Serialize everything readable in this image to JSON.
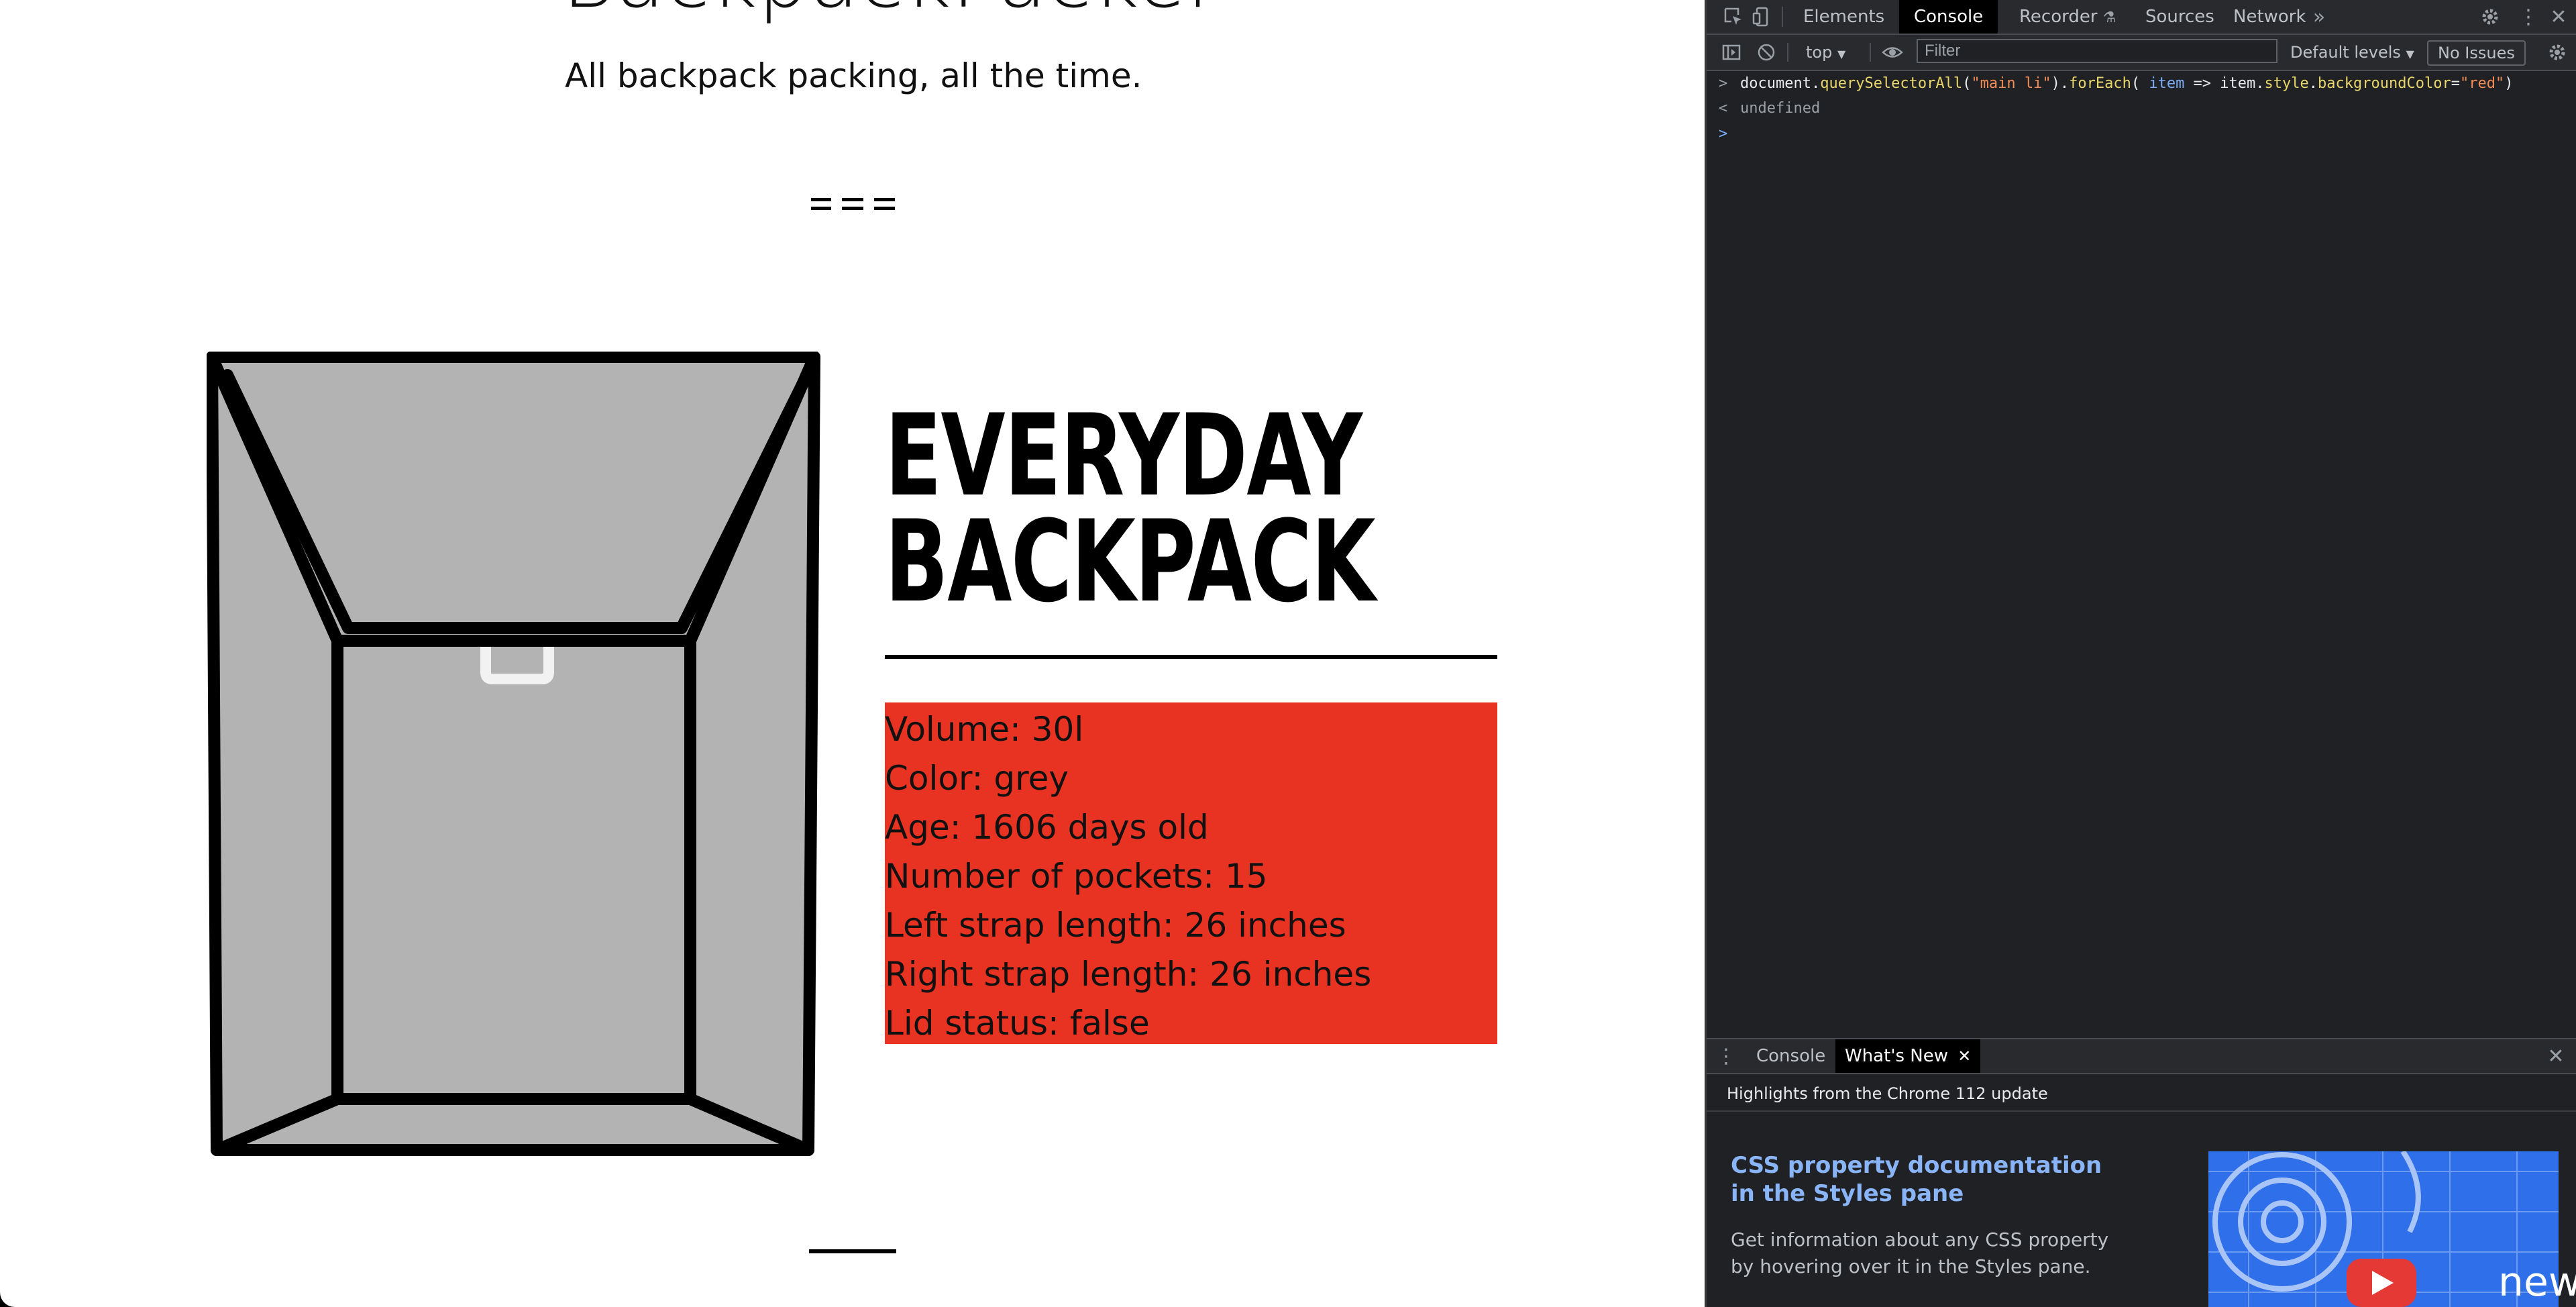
{
  "page": {
    "site_title": "BackpackPacker",
    "tagline": "All backpack packing, all the time.",
    "product_title": "EVERYDAY BACKPACK",
    "features": [
      "Volume: 30l",
      "Color: grey",
      "Age: 1606 days old",
      "Number of pockets: 15",
      "Left strap length: 26 inches",
      "Right strap length: 26 inches",
      "Lid status: false"
    ],
    "feature_highlight_color": "#e83323",
    "backpack_color": "#b3b3b3"
  },
  "devtools": {
    "tabs": [
      "Elements",
      "Console",
      "Recorder",
      "Sources",
      "Network"
    ],
    "active_tab": "Console",
    "more_tabs_icon": "chevron-double-right-icon",
    "toolbar": {
      "context": "top",
      "filter_placeholder": "Filter",
      "levels": "Default levels",
      "issues": "No Issues"
    },
    "console": {
      "input_prefix": ">",
      "output_prefix": "<",
      "prompt_prefix": ">",
      "input_parts": [
        {
          "t": "document.",
          "c": "tk-w"
        },
        {
          "t": "querySelectorAll",
          "c": "tk-y"
        },
        {
          "t": "(",
          "c": "tk-w"
        },
        {
          "t": "\"main li\"",
          "c": "tk-s"
        },
        {
          "t": ").",
          "c": "tk-w"
        },
        {
          "t": "forEach",
          "c": "tk-y"
        },
        {
          "t": "( ",
          "c": "tk-w"
        },
        {
          "t": "item",
          "c": "tk-b"
        },
        {
          "t": " => item.",
          "c": "tk-w"
        },
        {
          "t": "style",
          "c": "tk-y"
        },
        {
          "t": ".",
          "c": "tk-w"
        },
        {
          "t": "backgroundColor",
          "c": "tk-y"
        },
        {
          "t": "=",
          "c": "tk-w"
        },
        {
          "t": "\"red\"",
          "c": "tk-s"
        },
        {
          "t": ")",
          "c": "tk-w"
        }
      ],
      "output": "undefined"
    },
    "drawer": {
      "tabs": [
        "Console",
        "What's New"
      ],
      "active_tab": "What's New",
      "highlights": "Highlights from the Chrome 112 update",
      "article_title": "CSS property documentation in the Styles pane",
      "article_desc": "Get information about any CSS property by hovering over it in the Styles pane.",
      "thumb_label": "new"
    }
  }
}
